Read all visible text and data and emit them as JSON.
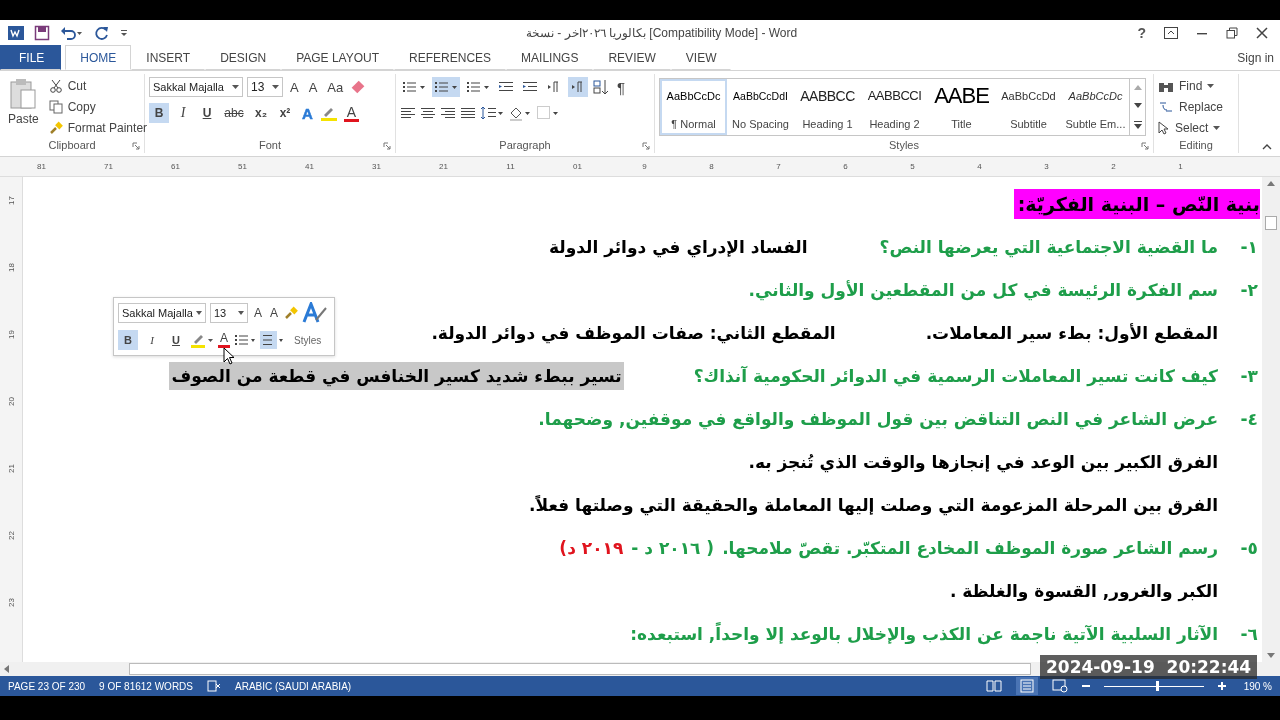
{
  "window": {
    "title": "بكالوريا ٢٠٢٦اخر - نسخة [Compatibility Mode] - Word",
    "help": "?"
  },
  "tabs": [
    {
      "label": "FILE",
      "kind": "file",
      "selected": false
    },
    {
      "label": "HOME",
      "kind": "tab",
      "selected": true
    },
    {
      "label": "INSERT",
      "kind": "tab",
      "selected": false
    },
    {
      "label": "DESIGN",
      "kind": "tab",
      "selected": false
    },
    {
      "label": "PAGE LAYOUT",
      "kind": "tab",
      "selected": false
    },
    {
      "label": "REFERENCES",
      "kind": "tab",
      "selected": false
    },
    {
      "label": "MAILINGS",
      "kind": "tab",
      "selected": false
    },
    {
      "label": "REVIEW",
      "kind": "tab",
      "selected": false
    },
    {
      "label": "VIEW",
      "kind": "tab",
      "selected": false
    }
  ],
  "sign_in": "Sign in",
  "clipboard": {
    "label": "Clipboard",
    "paste": "Paste",
    "items": [
      "Cut",
      "Copy",
      "Format Painter"
    ]
  },
  "font": {
    "label": "Font",
    "name": "Sakkal Majalla",
    "size": "13",
    "grow": "A",
    "shrink": "A",
    "case": "Aa",
    "effects": "A",
    "color_letter": "A",
    "format_buttons": [
      {
        "label": "B",
        "kind": "bold",
        "selected": true
      },
      {
        "label": "I",
        "kind": "italic",
        "selected": false
      },
      {
        "label": "U",
        "kind": "underline",
        "selected": false
      },
      {
        "label": "abc",
        "kind": "strike",
        "selected": false
      },
      {
        "label": "x₂",
        "kind": "sub",
        "selected": false
      },
      {
        "label": "x²",
        "kind": "sup",
        "selected": false
      }
    ]
  },
  "paragraph": {
    "label": "Paragraph",
    "show_marks": "¶",
    "toggles": [
      {
        "selected": false
      },
      {
        "selected": true
      },
      {
        "selected": false
      },
      {
        "selected": false
      },
      {
        "selected": false
      },
      {
        "selected": false
      },
      {
        "selected": true
      }
    ]
  },
  "styles": {
    "label": "Styles",
    "items": [
      {
        "sample": "AaBbCcDc",
        "name": "¶ Normal",
        "kind": "normal",
        "selected": true
      },
      {
        "sample": "AaBbCcDdI",
        "name": "No Spacing",
        "kind": "plain",
        "selected": false
      },
      {
        "sample": "AABBCC",
        "name": "Heading 1",
        "kind": "heading1",
        "selected": false
      },
      {
        "sample": "AABBCCI",
        "name": "Heading 2",
        "kind": "heading2",
        "selected": false
      },
      {
        "sample": "AABE",
        "name": "Title",
        "kind": "title",
        "selected": false
      },
      {
        "sample": "AaBbCcDd",
        "name": "Subtitle",
        "kind": "subtitle",
        "selected": false
      },
      {
        "sample": "AaBbCcDc",
        "name": "Subtle Em...",
        "kind": "emphasis",
        "selected": false
      }
    ]
  },
  "editing": {
    "label": "Editing",
    "items": [
      "Find",
      "Replace",
      "Select"
    ]
  },
  "ruler": {
    "horizontal": [
      "81",
      "71",
      "61",
      "51",
      "41",
      "31",
      "21",
      "11",
      "01",
      "9",
      "8",
      "7",
      "6",
      "5",
      "4",
      "3",
      "2",
      "1"
    ],
    "vertical": [
      "17",
      "18",
      "19",
      "20",
      "21",
      "22",
      "23"
    ]
  },
  "document": {
    "lines": [
      {
        "kind": "heading",
        "text": "بنية النّص – البنية الفكريّة:"
      },
      {
        "kind": "question",
        "number": "١-",
        "text": "ما القضية الاجتماعية التي يعرضها النص؟",
        "answer": {
          "text": "الفساد الإدراي في دوائر الدولة",
          "highlighted": false
        }
      },
      {
        "kind": "question",
        "number": "٢-",
        "text": "سم الفكرة الرئيسة في كل من المقطعين الأول والثاني."
      },
      {
        "kind": "answer_pair",
        "parts": [
          "المقطع الأول: بطء سير المعاملات.",
          "المقطع الثاني: صفات الموظف في دوائر الدولة."
        ]
      },
      {
        "kind": "question",
        "number": "٣-",
        "text": "كيف كانت تسير المعاملات الرسمية في الدوائر الحكومية آنذاك؟",
        "answer": {
          "text": "تسير ببطء شديد كسير الخنافس في قطعة من الصوف",
          "highlighted": true
        }
      },
      {
        "kind": "question",
        "number": "٤-",
        "text": "عرض الشاعر في النص التناقض بين قول الموظف والواقع في موقفين, وضحهما."
      },
      {
        "kind": "answer",
        "text": "الفرق الكبير بين الوعد في إنجازها والوقت الذي تُنجز به."
      },
      {
        "kind": "answer",
        "text": "الفرق بين المرحلة المزعومة التي وصلت إليها المعاملة والحقيقة التي وصلتها فعلاً."
      },
      {
        "kind": "question",
        "number": "٥-",
        "text": "رسم الشاعر صورة الموظف المخادع المتكبّر. تقصّ ملامحها.",
        "notes": [
          {
            "text": "( ٢٠١٦ د -",
            "color": "#1e9e4a"
          },
          {
            "text": "٢٠١٩ د)",
            "color": "#e0141e"
          }
        ]
      },
      {
        "kind": "answer",
        "text": "الكبر والغرور, القسوة والغلظة ."
      },
      {
        "kind": "question",
        "number": "٦-",
        "text": "الآثار السلبية الآتية ناجمة عن الكذب والإخلال بالوعد إلا واحداً, استبعده:"
      }
    ]
  },
  "mini_toolbar": {
    "font_name": "Sakkal Majalla",
    "font_size": "13",
    "grow": "A",
    "shrink": "A",
    "styles_label": "Styles",
    "color_letter": "A",
    "format_buttons": [
      {
        "label": "B",
        "kind": "bold",
        "selected": true
      },
      {
        "label": "I",
        "kind": "italic",
        "selected": false
      },
      {
        "label": "U",
        "kind": "underline",
        "selected": false
      }
    ]
  },
  "status": {
    "page": "PAGE 23 OF 230",
    "words": "9 OF 81612 WORDS",
    "language": "ARABIC (SAUDI ARABIA)",
    "zoom": {
      "level": 0.55,
      "reading": "190 %"
    }
  },
  "timestamp": "2024-09-19  20:22:44"
}
